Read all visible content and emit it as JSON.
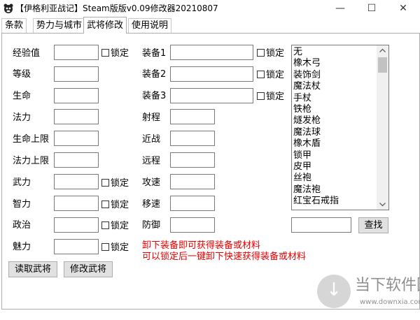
{
  "window": {
    "title": "【伊格利亚战记】Steam版版v0.09修改器20210807",
    "minimize_glyph": "—",
    "maximize_glyph": "☐",
    "close_glyph": "✕"
  },
  "tabs": [
    {
      "label": "条款"
    },
    {
      "label": "势力与城市"
    },
    {
      "label": "武将修改"
    },
    {
      "label": "使用说明"
    }
  ],
  "lock_label": "锁定",
  "left_fields": {
    "exp": "经验值",
    "level": "等级",
    "hp": "生命",
    "mp": "法力",
    "hp_max": "生命上限",
    "mp_max": "法力上限",
    "force": "武力",
    "intel": "智力",
    "politics": "政治",
    "charm": "魅力"
  },
  "mid_fields": {
    "equip1": "装备1",
    "equip2": "装备2",
    "equip3": "装备3",
    "range": "射程",
    "melee": "近战",
    "ranged": "远程",
    "atk_speed": "攻速",
    "move_speed": "移速",
    "defense": "防御"
  },
  "equipment_list": [
    "无",
    "橡木弓",
    "装饰剑",
    "魔法杖",
    "手杖",
    "铁枪",
    "燧发枪",
    "魔法球",
    "橡木盾",
    "锁甲",
    "皮甲",
    "丝袍",
    "魔法袍",
    "红宝石戒指"
  ],
  "buttons": {
    "read": "读取武将",
    "modify": "修改武将",
    "search": "查找"
  },
  "notices": {
    "line1": "卸下装备即可获得装备或材料",
    "line2": "可以锁定后一键卸下快速获得装备或材料"
  },
  "watermark": {
    "logo_glyph": "↓",
    "name": "当下软件园",
    "url": "www.downxia.com"
  }
}
